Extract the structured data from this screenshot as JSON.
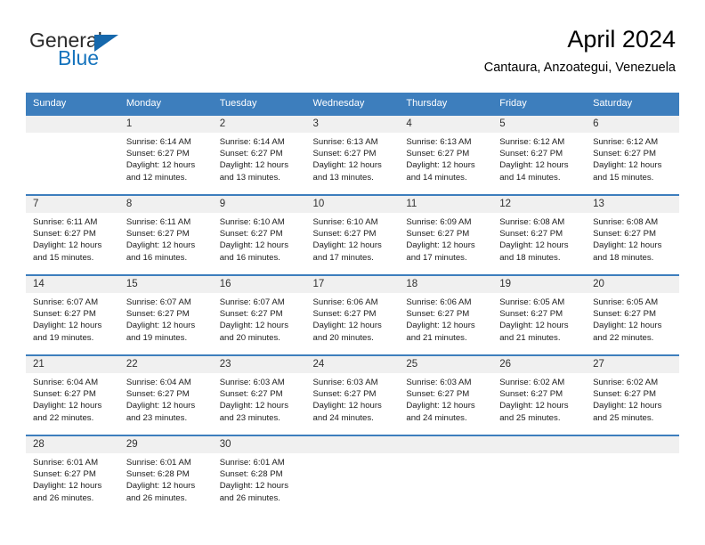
{
  "brand": {
    "name_part1": "General",
    "name_part2": "Blue",
    "accent_color": "#1573bd",
    "triangle_color": "#1668ac"
  },
  "header": {
    "title": "April 2024",
    "subtitle": "Cantaura, Anzoategui, Venezuela"
  },
  "calendar": {
    "header_color": "#3d7ebd",
    "weekday_headers": [
      "Sunday",
      "Monday",
      "Tuesday",
      "Wednesday",
      "Thursday",
      "Friday",
      "Saturday"
    ],
    "weeks": [
      [
        {
          "day": "",
          "empty": true,
          "sunrise": "",
          "sunset": "",
          "daylight1": "",
          "daylight2": ""
        },
        {
          "day": "1",
          "sunrise": "Sunrise: 6:14 AM",
          "sunset": "Sunset: 6:27 PM",
          "daylight1": "Daylight: 12 hours",
          "daylight2": "and 12 minutes."
        },
        {
          "day": "2",
          "sunrise": "Sunrise: 6:14 AM",
          "sunset": "Sunset: 6:27 PM",
          "daylight1": "Daylight: 12 hours",
          "daylight2": "and 13 minutes."
        },
        {
          "day": "3",
          "sunrise": "Sunrise: 6:13 AM",
          "sunset": "Sunset: 6:27 PM",
          "daylight1": "Daylight: 12 hours",
          "daylight2": "and 13 minutes."
        },
        {
          "day": "4",
          "sunrise": "Sunrise: 6:13 AM",
          "sunset": "Sunset: 6:27 PM",
          "daylight1": "Daylight: 12 hours",
          "daylight2": "and 14 minutes."
        },
        {
          "day": "5",
          "sunrise": "Sunrise: 6:12 AM",
          "sunset": "Sunset: 6:27 PM",
          "daylight1": "Daylight: 12 hours",
          "daylight2": "and 14 minutes."
        },
        {
          "day": "6",
          "sunrise": "Sunrise: 6:12 AM",
          "sunset": "Sunset: 6:27 PM",
          "daylight1": "Daylight: 12 hours",
          "daylight2": "and 15 minutes."
        }
      ],
      [
        {
          "day": "7",
          "sunrise": "Sunrise: 6:11 AM",
          "sunset": "Sunset: 6:27 PM",
          "daylight1": "Daylight: 12 hours",
          "daylight2": "and 15 minutes."
        },
        {
          "day": "8",
          "sunrise": "Sunrise: 6:11 AM",
          "sunset": "Sunset: 6:27 PM",
          "daylight1": "Daylight: 12 hours",
          "daylight2": "and 16 minutes."
        },
        {
          "day": "9",
          "sunrise": "Sunrise: 6:10 AM",
          "sunset": "Sunset: 6:27 PM",
          "daylight1": "Daylight: 12 hours",
          "daylight2": "and 16 minutes."
        },
        {
          "day": "10",
          "sunrise": "Sunrise: 6:10 AM",
          "sunset": "Sunset: 6:27 PM",
          "daylight1": "Daylight: 12 hours",
          "daylight2": "and 17 minutes."
        },
        {
          "day": "11",
          "sunrise": "Sunrise: 6:09 AM",
          "sunset": "Sunset: 6:27 PM",
          "daylight1": "Daylight: 12 hours",
          "daylight2": "and 17 minutes."
        },
        {
          "day": "12",
          "sunrise": "Sunrise: 6:08 AM",
          "sunset": "Sunset: 6:27 PM",
          "daylight1": "Daylight: 12 hours",
          "daylight2": "and 18 minutes."
        },
        {
          "day": "13",
          "sunrise": "Sunrise: 6:08 AM",
          "sunset": "Sunset: 6:27 PM",
          "daylight1": "Daylight: 12 hours",
          "daylight2": "and 18 minutes."
        }
      ],
      [
        {
          "day": "14",
          "sunrise": "Sunrise: 6:07 AM",
          "sunset": "Sunset: 6:27 PM",
          "daylight1": "Daylight: 12 hours",
          "daylight2": "and 19 minutes."
        },
        {
          "day": "15",
          "sunrise": "Sunrise: 6:07 AM",
          "sunset": "Sunset: 6:27 PM",
          "daylight1": "Daylight: 12 hours",
          "daylight2": "and 19 minutes."
        },
        {
          "day": "16",
          "sunrise": "Sunrise: 6:07 AM",
          "sunset": "Sunset: 6:27 PM",
          "daylight1": "Daylight: 12 hours",
          "daylight2": "and 20 minutes."
        },
        {
          "day": "17",
          "sunrise": "Sunrise: 6:06 AM",
          "sunset": "Sunset: 6:27 PM",
          "daylight1": "Daylight: 12 hours",
          "daylight2": "and 20 minutes."
        },
        {
          "day": "18",
          "sunrise": "Sunrise: 6:06 AM",
          "sunset": "Sunset: 6:27 PM",
          "daylight1": "Daylight: 12 hours",
          "daylight2": "and 21 minutes."
        },
        {
          "day": "19",
          "sunrise": "Sunrise: 6:05 AM",
          "sunset": "Sunset: 6:27 PM",
          "daylight1": "Daylight: 12 hours",
          "daylight2": "and 21 minutes."
        },
        {
          "day": "20",
          "sunrise": "Sunrise: 6:05 AM",
          "sunset": "Sunset: 6:27 PM",
          "daylight1": "Daylight: 12 hours",
          "daylight2": "and 22 minutes."
        }
      ],
      [
        {
          "day": "21",
          "sunrise": "Sunrise: 6:04 AM",
          "sunset": "Sunset: 6:27 PM",
          "daylight1": "Daylight: 12 hours",
          "daylight2": "and 22 minutes."
        },
        {
          "day": "22",
          "sunrise": "Sunrise: 6:04 AM",
          "sunset": "Sunset: 6:27 PM",
          "daylight1": "Daylight: 12 hours",
          "daylight2": "and 23 minutes."
        },
        {
          "day": "23",
          "sunrise": "Sunrise: 6:03 AM",
          "sunset": "Sunset: 6:27 PM",
          "daylight1": "Daylight: 12 hours",
          "daylight2": "and 23 minutes."
        },
        {
          "day": "24",
          "sunrise": "Sunrise: 6:03 AM",
          "sunset": "Sunset: 6:27 PM",
          "daylight1": "Daylight: 12 hours",
          "daylight2": "and 24 minutes."
        },
        {
          "day": "25",
          "sunrise": "Sunrise: 6:03 AM",
          "sunset": "Sunset: 6:27 PM",
          "daylight1": "Daylight: 12 hours",
          "daylight2": "and 24 minutes."
        },
        {
          "day": "26",
          "sunrise": "Sunrise: 6:02 AM",
          "sunset": "Sunset: 6:27 PM",
          "daylight1": "Daylight: 12 hours",
          "daylight2": "and 25 minutes."
        },
        {
          "day": "27",
          "sunrise": "Sunrise: 6:02 AM",
          "sunset": "Sunset: 6:27 PM",
          "daylight1": "Daylight: 12 hours",
          "daylight2": "and 25 minutes."
        }
      ],
      [
        {
          "day": "28",
          "sunrise": "Sunrise: 6:01 AM",
          "sunset": "Sunset: 6:27 PM",
          "daylight1": "Daylight: 12 hours",
          "daylight2": "and 26 minutes."
        },
        {
          "day": "29",
          "sunrise": "Sunrise: 6:01 AM",
          "sunset": "Sunset: 6:28 PM",
          "daylight1": "Daylight: 12 hours",
          "daylight2": "and 26 minutes."
        },
        {
          "day": "30",
          "sunrise": "Sunrise: 6:01 AM",
          "sunset": "Sunset: 6:28 PM",
          "daylight1": "Daylight: 12 hours",
          "daylight2": "and 26 minutes."
        },
        {
          "day": "",
          "empty": true,
          "sunrise": "",
          "sunset": "",
          "daylight1": "",
          "daylight2": ""
        },
        {
          "day": "",
          "empty": true,
          "sunrise": "",
          "sunset": "",
          "daylight1": "",
          "daylight2": ""
        },
        {
          "day": "",
          "empty": true,
          "sunrise": "",
          "sunset": "",
          "daylight1": "",
          "daylight2": ""
        },
        {
          "day": "",
          "empty": true,
          "sunrise": "",
          "sunset": "",
          "daylight1": "",
          "daylight2": ""
        }
      ]
    ]
  }
}
